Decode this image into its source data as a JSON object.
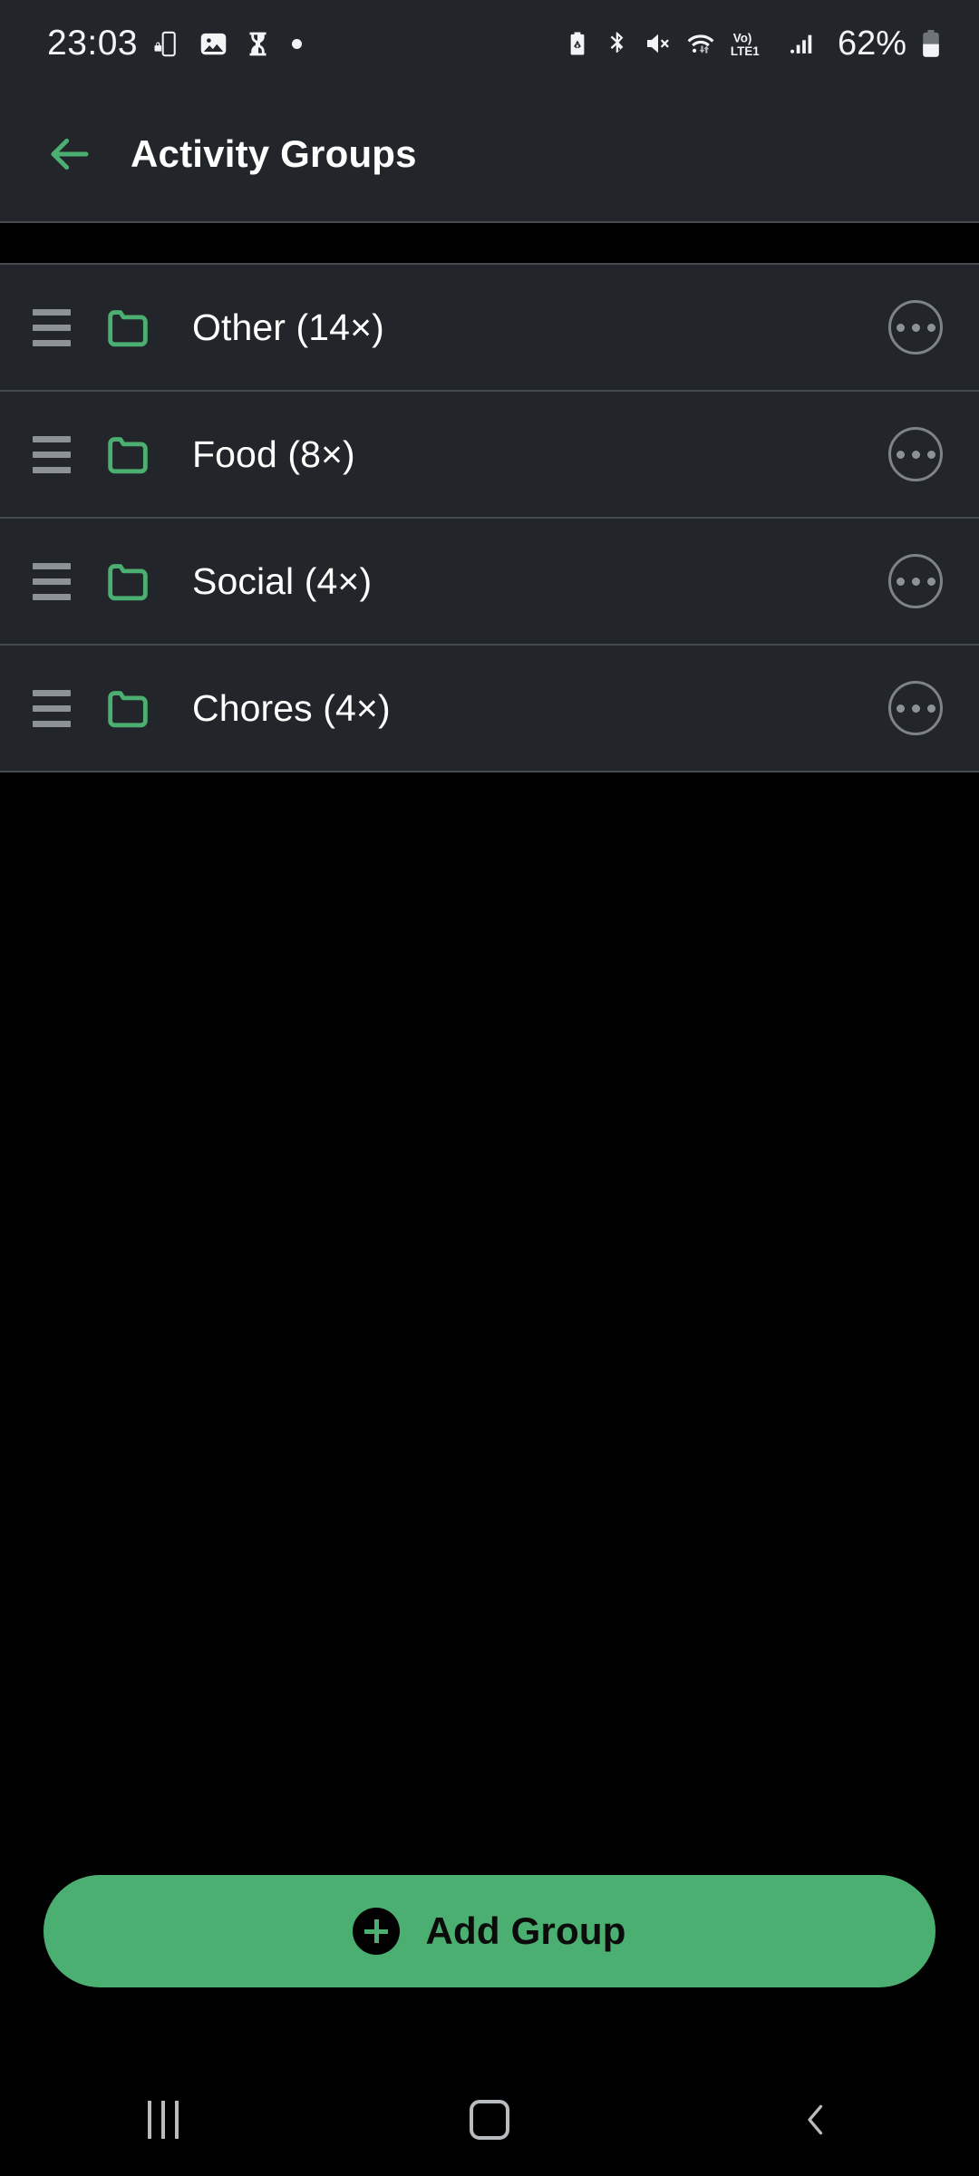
{
  "status_bar": {
    "time": "23:03",
    "left_icons": [
      "screen-lock-rotation-icon",
      "image-icon",
      "hourglass-icon",
      "dot-indicator-icon"
    ],
    "right_icons": [
      "battery-saver-icon",
      "bluetooth-icon",
      "mute-icon",
      "wifi-icon",
      "volte-lte1-icon",
      "signal-bars-icon"
    ],
    "volte_label": "Vo)",
    "network_label": "LTE1",
    "battery_percent": "62%"
  },
  "app_bar": {
    "back_icon": "back-arrow-icon",
    "title": "Activity Groups"
  },
  "groups": [
    {
      "name": "Other (14×)",
      "drag_icon": "drag-handle-icon",
      "folder_icon": "folder-icon",
      "menu_icon": "overflow-menu-icon"
    },
    {
      "name": "Food (8×)",
      "drag_icon": "drag-handle-icon",
      "folder_icon": "folder-icon",
      "menu_icon": "overflow-menu-icon"
    },
    {
      "name": "Social (4×)",
      "drag_icon": "drag-handle-icon",
      "folder_icon": "folder-icon",
      "menu_icon": "overflow-menu-icon"
    },
    {
      "name": "Chores (4×)",
      "drag_icon": "drag-handle-icon",
      "folder_icon": "folder-icon",
      "menu_icon": "overflow-menu-icon"
    }
  ],
  "add_button": {
    "label": "Add Group",
    "icon": "plus-circle-icon"
  },
  "nav_bar": {
    "recents": "recents-icon",
    "home": "home-icon",
    "back": "back-icon"
  },
  "colors": {
    "accent_green": "#4caf72",
    "surface": "#22262a",
    "background": "#000000",
    "divider": "#454a4e",
    "text_primary": "#ffffff",
    "text_muted": "#8d9297"
  }
}
